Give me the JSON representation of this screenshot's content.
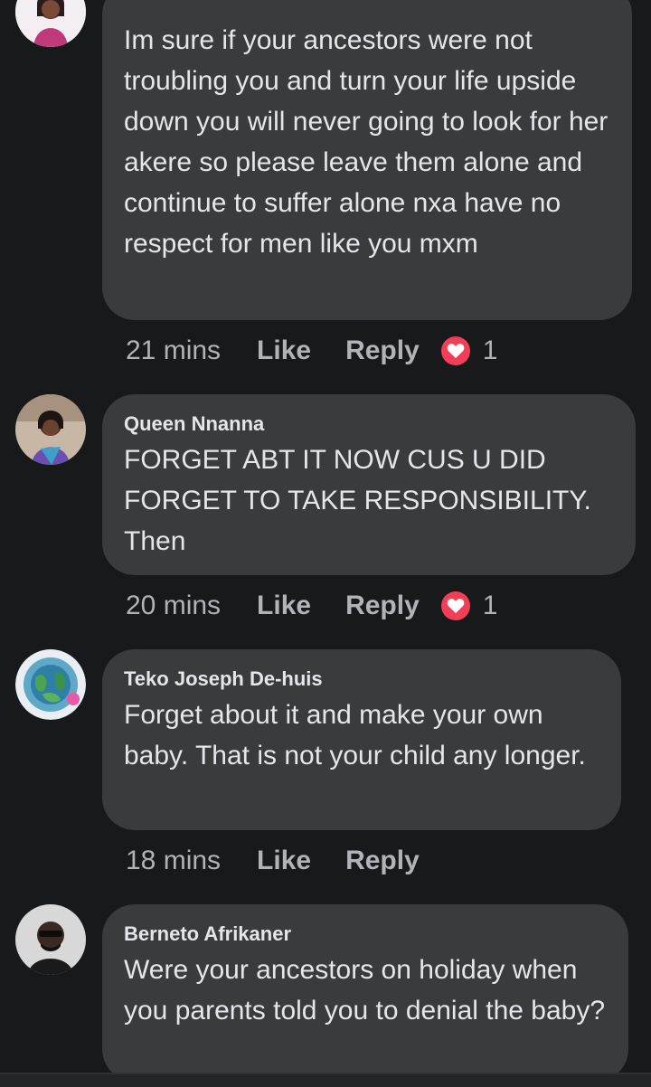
{
  "comments": [
    {
      "author": "",
      "text": "Im sure if your ancestors were not troubling you and turn your life upside down you will never going to look for her akere so please leave them alone and continue to suffer alone nxa have no respect for men like you mxm",
      "time": "21 mins",
      "like_label": "Like",
      "reply_label": "Reply",
      "reaction_icon": "heart-icon",
      "reaction_count": "1"
    },
    {
      "author": "Queen Nnanna",
      "text": "FORGET ABT IT NOW CUS U DID FORGET TO TAKE RESPONSIBILITY. Then",
      "time": "20 mins",
      "like_label": "Like",
      "reply_label": "Reply",
      "reaction_icon": "heart-icon",
      "reaction_count": "1"
    },
    {
      "author": "Teko Joseph De-huis",
      "text": "Forget about it and make your own baby. That is not your child any longer.",
      "time": "18 mins",
      "like_label": "Like",
      "reply_label": "Reply"
    },
    {
      "author": "Berneto Afrikaner",
      "text": "Were your ancestors on holiday when you parents told you to denial the baby?"
    }
  ],
  "colors": {
    "background": "#18191a",
    "bubble": "#3a3b3c",
    "text": "#e4e6eb",
    "secondary_text": "#b0b3b8",
    "heart": "#f33e58"
  }
}
